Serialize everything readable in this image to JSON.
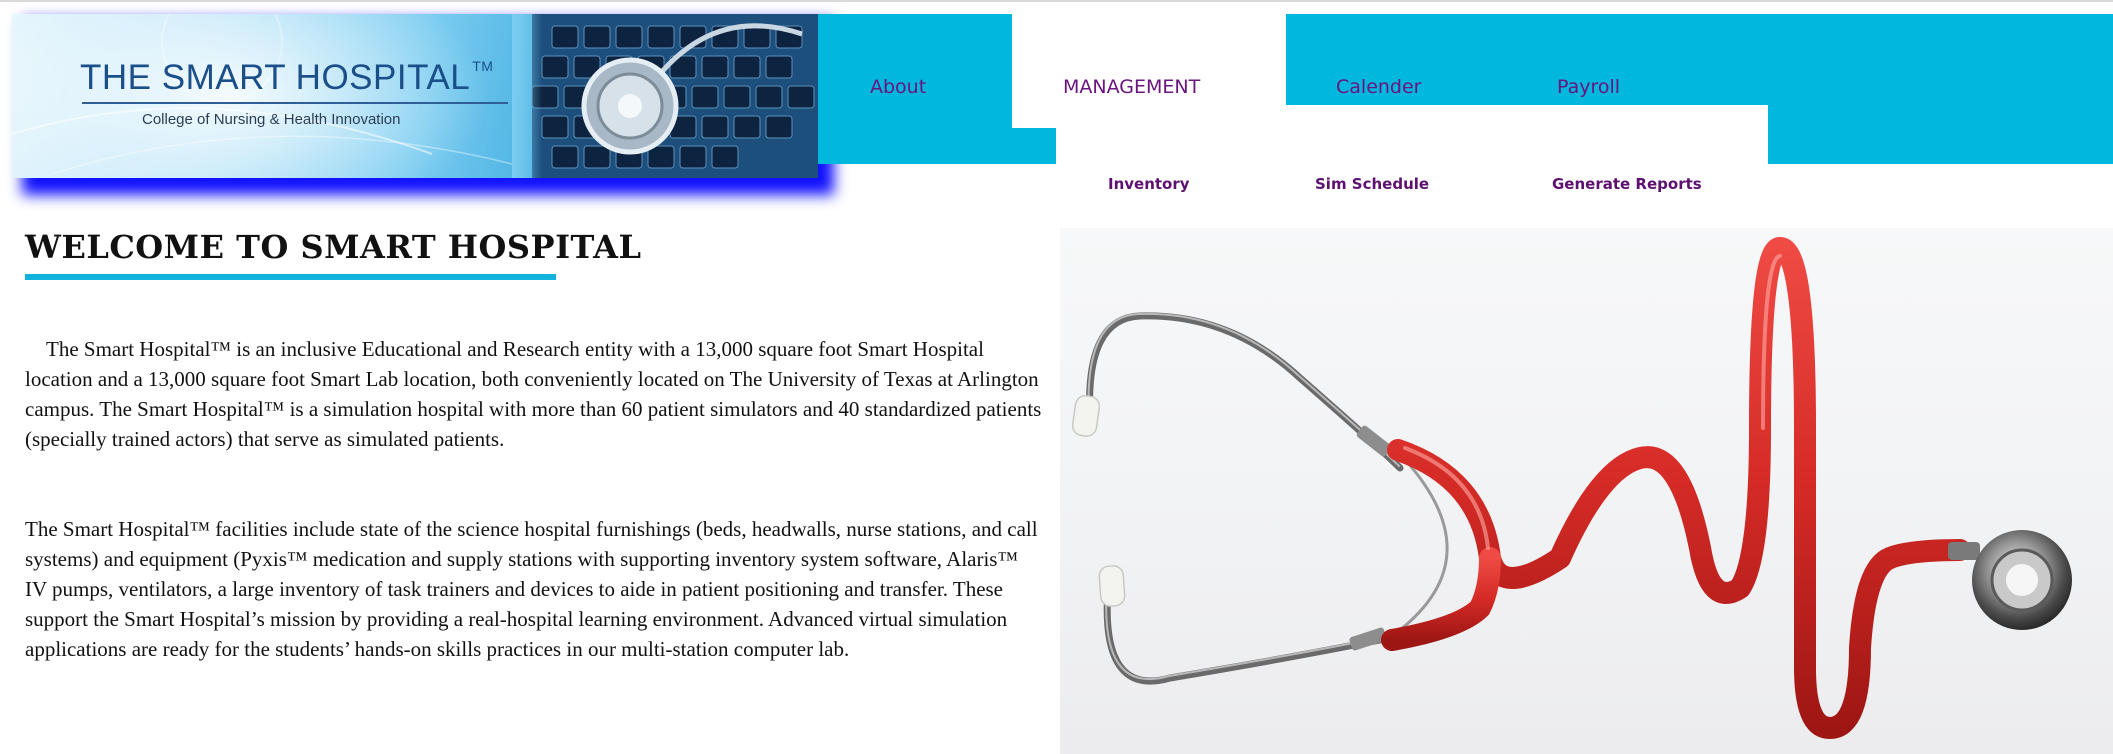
{
  "header": {
    "logo_title": "THE SMART HOSPITAL",
    "logo_tm": "TM",
    "logo_subtitle": "College of Nursing & Health Innovation"
  },
  "nav": {
    "items": [
      {
        "label": "About"
      },
      {
        "label": "MANAGEMENT",
        "active": true
      },
      {
        "label": "Calender"
      },
      {
        "label": "Payroll"
      }
    ],
    "submenu": [
      {
        "label": "Inventory"
      },
      {
        "label": "Sim Schedule"
      },
      {
        "label": "Generate Reports"
      }
    ]
  },
  "main": {
    "heading": "Welcome to Smart Hospital",
    "paragraphs": [
      "The Smart Hospital™ is an inclusive Educational and Research entity with a 13,000 square foot Smart Hospital location and a 13,000 square foot Smart Lab location, both conveniently located on The University of Texas at Arlington campus. The Smart Hospital™ is a simulation hospital with more than 60 patient simulators and 40 standardized patients (specially trained actors) that serve as simulated patients.",
      "The Smart Hospital™ facilities include state of the science hospital furnishings (beds, headwalls, nurse stations, and call systems) and equipment (Pyxis™ medication and supply stations with supporting inventory system software, Alaris™ IV pumps, ventilators, a large inventory of task trainers and devices to aide in patient positioning and transfer. These support the Smart Hospital’s mission by providing a real-hospital learning environment. Advanced virtual simulation applications are ready for the students’ hands-on skills practices in our multi-station computer lab."
    ]
  },
  "colors": {
    "nav_band": "#00b7de",
    "nav_text": "#6b1480",
    "heading_rule": "#11b2dc",
    "logo_shadow": "#1111ff",
    "stethoscope_tube": "#d42a26"
  },
  "icons": {
    "logo_image": "stethoscope-on-keyboard-icon",
    "hero_image": "stethoscope-heartbeat-icon"
  }
}
